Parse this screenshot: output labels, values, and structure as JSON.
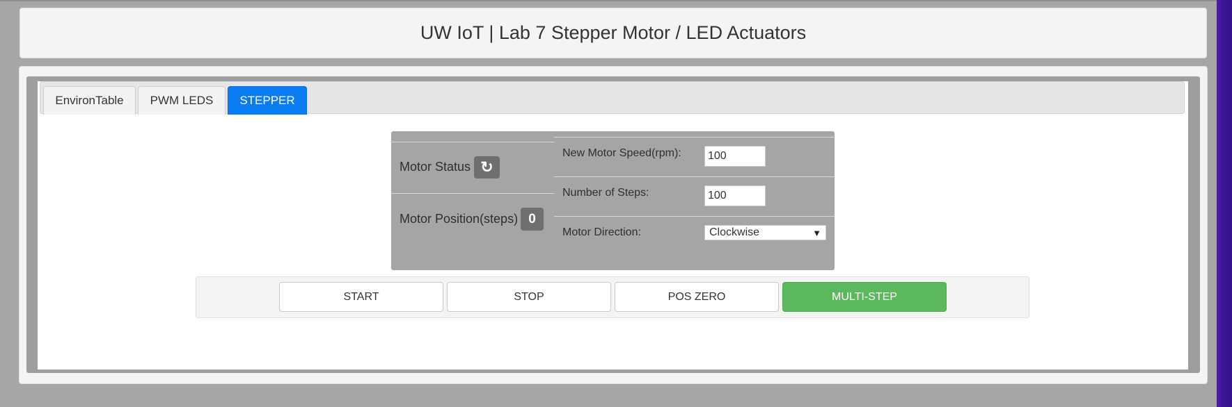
{
  "header": {
    "title": "UW IoT | Lab 7 Stepper Motor / LED Actuators"
  },
  "tabs": [
    {
      "label": "EnvironTable",
      "active": false
    },
    {
      "label": "PWM LEDS",
      "active": false
    },
    {
      "label": "STEPPER",
      "active": true
    }
  ],
  "stepper": {
    "motor_status_label": "Motor Status",
    "motor_status_icon": "refresh-icon",
    "motor_status_glyph": "↻",
    "motor_position_label": "Motor Position(steps)",
    "motor_position_value": "0",
    "speed_label": "New Motor Speed(rpm):",
    "speed_value": "100",
    "steps_label": "Number of Steps:",
    "steps_value": "100",
    "direction_label": "Motor Direction:",
    "direction_value": "Clockwise",
    "direction_arrow": "▼"
  },
  "buttons": {
    "start": "START",
    "stop": "STOP",
    "pos_zero": "POS ZERO",
    "multi_step": "MULTI-STEP"
  },
  "colors": {
    "active_tab": "#0a7cf2",
    "multi_step": "#5cb85c",
    "badge": "#6f6f6f",
    "status_box": "#a5a5a5"
  }
}
